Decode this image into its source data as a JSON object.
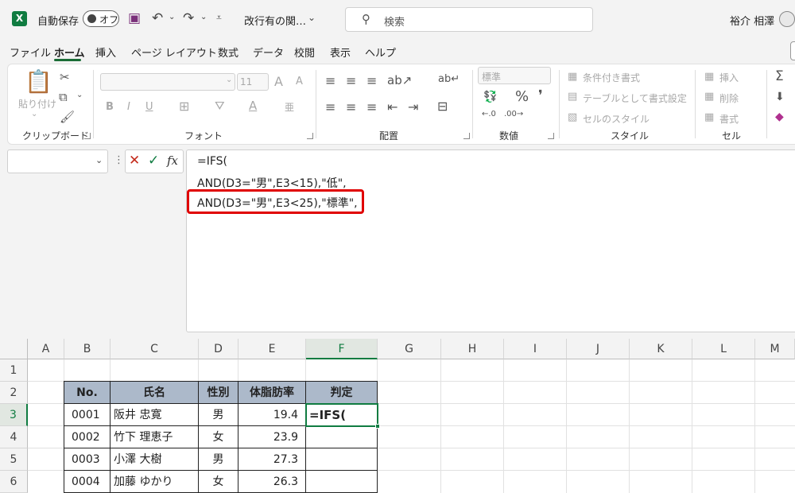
{
  "titlebar": {
    "autosave_label": "自動保存",
    "toggle_state": "オフ",
    "doc_title": "改行有の関…",
    "search_placeholder": "検索",
    "user": "裕介 相澤"
  },
  "tabs": [
    "ファイル",
    "ホーム",
    "挿入",
    "ページ レイアウト",
    "数式",
    "データ",
    "校閲",
    "表示",
    "ヘルプ"
  ],
  "active_tab": "ホーム",
  "ribbon": {
    "clipboard": {
      "group": "クリップボード",
      "paste": "貼り付け"
    },
    "font": {
      "group": "フォント",
      "size": "11"
    },
    "alignment": {
      "group": "配置"
    },
    "number": {
      "group": "数値",
      "format": "標準"
    },
    "styles": {
      "group": "スタイル",
      "conditional": "条件付き書式",
      "table": "テーブルとして書式設定",
      "cell_styles": "セルのスタイル"
    },
    "cells": {
      "group": "セル",
      "insert": "挿入",
      "delete": "削除",
      "format": "書式"
    }
  },
  "formula_bar": {
    "name_box": "",
    "fx": "fx",
    "lines": [
      "=IFS(",
      "AND(D3=\"男\",E3<15),\"低\",",
      "AND(D3=\"男\",E3<25),\"標準\","
    ]
  },
  "columns": [
    "A",
    "B",
    "C",
    "D",
    "E",
    "F",
    "G",
    "H",
    "I",
    "J",
    "K",
    "L",
    "M"
  ],
  "rows": [
    "1",
    "2",
    "3",
    "4",
    "5",
    "6"
  ],
  "table": {
    "headers": [
      "No.",
      "氏名",
      "性別",
      "体脂肪率",
      "判定"
    ],
    "rows": [
      {
        "no": "0001",
        "name": "阪井 忠寛",
        "sex": "男",
        "fat": "19.4",
        "judge": "=IFS("
      },
      {
        "no": "0002",
        "name": "竹下 理恵子",
        "sex": "女",
        "fat": "23.9",
        "judge": ""
      },
      {
        "no": "0003",
        "name": "小澤 大樹",
        "sex": "男",
        "fat": "27.3",
        "judge": ""
      },
      {
        "no": "0004",
        "name": "加藤 ゆかり",
        "sex": "女",
        "fat": "26.3",
        "judge": ""
      }
    ]
  },
  "colors": {
    "excel_green": "#107c41",
    "header_fill": "#acb9ca",
    "highlight": "#e00000"
  }
}
